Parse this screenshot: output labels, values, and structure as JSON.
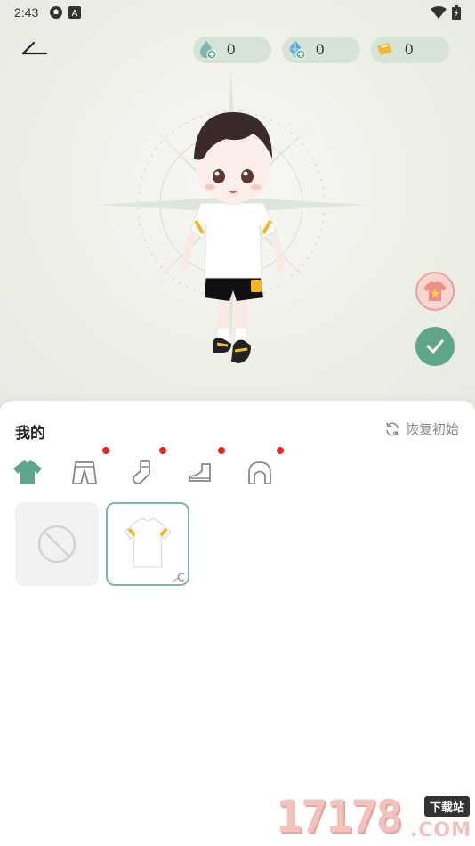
{
  "status": {
    "time": "2:43",
    "left_icons": [
      "soccer-icon",
      "a-icon"
    ],
    "right_icons": [
      "wifi-icon",
      "battery-icon"
    ]
  },
  "currencies": [
    {
      "name": "water-drop-currency",
      "value": "0"
    },
    {
      "name": "diamond-currency",
      "value": "0"
    },
    {
      "name": "ticket-currency",
      "value": "0"
    }
  ],
  "panel": {
    "title": "我的",
    "reset_label": "恢复初始",
    "categories": [
      {
        "name": "top",
        "icon": "tshirt-icon",
        "active": true,
        "has_dot": false
      },
      {
        "name": "bottom",
        "icon": "pants-icon",
        "active": false,
        "has_dot": true
      },
      {
        "name": "socks",
        "icon": "sock-icon",
        "active": false,
        "has_dot": true
      },
      {
        "name": "shoes",
        "icon": "shoe-icon",
        "active": false,
        "has_dot": true
      },
      {
        "name": "hair",
        "icon": "hair-icon",
        "active": false,
        "has_dot": true
      }
    ],
    "items": [
      {
        "name": "none-option",
        "icon": "no-entry-icon",
        "selected": false
      },
      {
        "name": "white-tshirt",
        "icon": "tshirt-thumbnail",
        "selected": true,
        "corner_badge": "C"
      }
    ]
  },
  "watermark": {
    "number": "17178",
    "badge": "下载站",
    "domain": ".COM"
  },
  "colors": {
    "accent": "#5fa58a",
    "currency_pill": "#d6e3d5",
    "notification": "#e22222"
  }
}
